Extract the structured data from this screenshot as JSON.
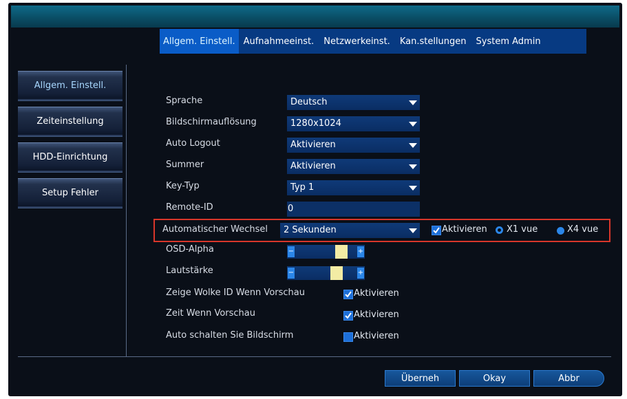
{
  "tabs": [
    {
      "label": "Allgem. Einstell.",
      "active": true
    },
    {
      "label": "Aufnahmeeinst.",
      "active": false
    },
    {
      "label": "Netzwerkeinst.",
      "active": false
    },
    {
      "label": "Kan.stellungen",
      "active": false
    },
    {
      "label": "System Admin",
      "active": false
    }
  ],
  "sidebar": {
    "items": [
      {
        "label": "Allgem. Einstell.",
        "active": true
      },
      {
        "label": "Zeiteinstellung",
        "active": false
      },
      {
        "label": "HDD-Einrichtung",
        "active": false
      },
      {
        "label": "Setup Fehler",
        "active": false
      }
    ]
  },
  "settings": {
    "sprache": {
      "label": "Sprache",
      "value": "Deutsch"
    },
    "aufloesung": {
      "label": "Bildschirmauflösung",
      "value": "1280x1024"
    },
    "logout": {
      "label": "Auto Logout",
      "value": "Aktivieren"
    },
    "summer": {
      "label": "Summer",
      "value": "Aktivieren"
    },
    "keytyp": {
      "label": "Key-Typ",
      "value": "Typ 1"
    },
    "remote": {
      "label": "Remote-ID",
      "value": "0"
    },
    "wechsel": {
      "label": "Automatischer Wechsel",
      "value": "2 Sekunden",
      "checkbox_label": "Aktivieren",
      "checked": true,
      "radio_x1": "X1 vue",
      "radio_x4": "X4 vue",
      "selected_radio": "X4 vue"
    },
    "osd": {
      "label": "OSD-Alpha",
      "level": 0.82
    },
    "laut": {
      "label": "Lautstärke",
      "level": 0.72
    },
    "wolke": {
      "label": "Zeige Wolke ID Wenn Vorschau",
      "checkbox_label": "Aktivieren",
      "checked": true
    },
    "zeit": {
      "label": "Zeit Wenn Vorschau",
      "checkbox_label": "Aktivieren",
      "checked": true
    },
    "bildschirm": {
      "label": "Auto schalten Sie Bildschirm",
      "checkbox_label": "Aktivieren",
      "checked": false
    }
  },
  "buttons": {
    "apply": "Überneh",
    "ok": "Okay",
    "cancel": "Abbr"
  },
  "colors": {
    "background": "#0a0f18",
    "tab_bar": "#073a82",
    "active_tab": "#0a5cc7",
    "highlight_box": "#d9362a",
    "accent": "#2b86e8"
  }
}
